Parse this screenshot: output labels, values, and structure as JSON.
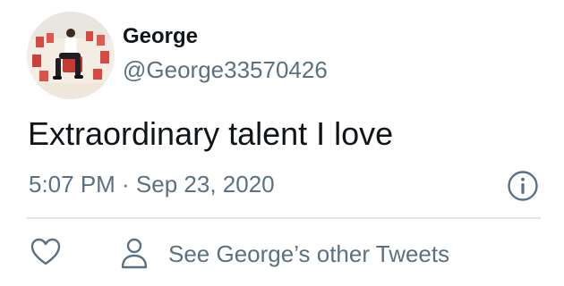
{
  "tweet": {
    "author": {
      "display_name": "George",
      "handle": "@George33570426",
      "avatar_icon": "profile-photo"
    },
    "text": "Extraordinary talent I love",
    "timestamp": "5:07 PM · Sep 23, 2020",
    "info_icon": "info-icon"
  },
  "actions": {
    "like_icon": "heart-icon",
    "other_tweets_icon": "person-icon",
    "other_tweets_label": "See George’s other Tweets"
  },
  "colors": {
    "primary_text": "#111518",
    "secondary_text": "#5b7083",
    "divider": "#dfe5ea",
    "background": "#ffffff"
  }
}
